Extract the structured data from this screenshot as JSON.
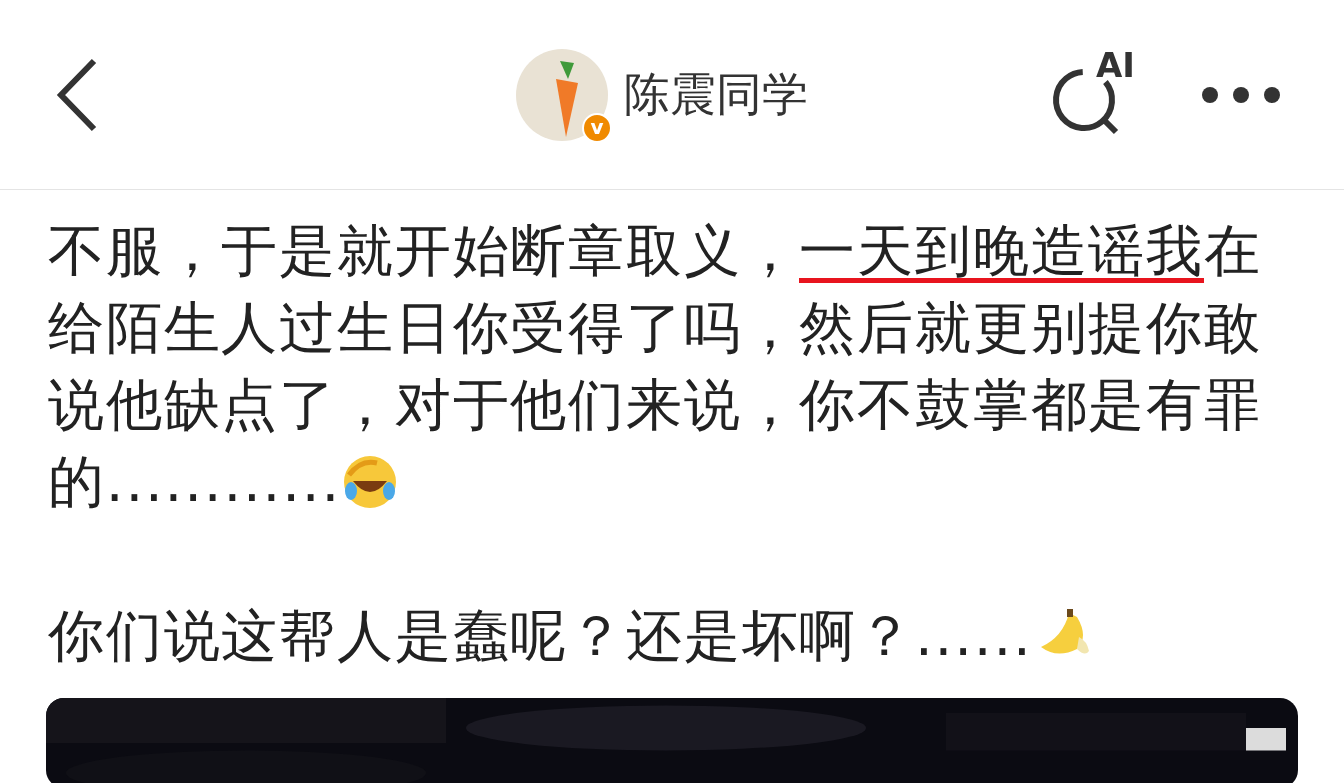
{
  "header": {
    "author": "陈震同学",
    "verified_badge": "v",
    "ai_search_label": "AI"
  },
  "post": {
    "paragraphs": [
      {
        "segments": [
          {
            "text": "不服，于是就开始断章取义，",
            "underlined": false
          },
          {
            "text": "一天到晚造谣我",
            "underlined": true
          },
          {
            "text": "在给陌生人过生日你受得了吗，然后就更别提你敢说他缺点了，对于他们来说，你不鼓掌都是有罪的............",
            "underlined": false
          }
        ],
        "kind": "laughing-crying"
      },
      {
        "segments": [
          {
            "text": "你们说这帮人是蠢呢？还是坏啊？......",
            "underlined": false
          }
        ],
        "kind": "banana"
      }
    ]
  }
}
